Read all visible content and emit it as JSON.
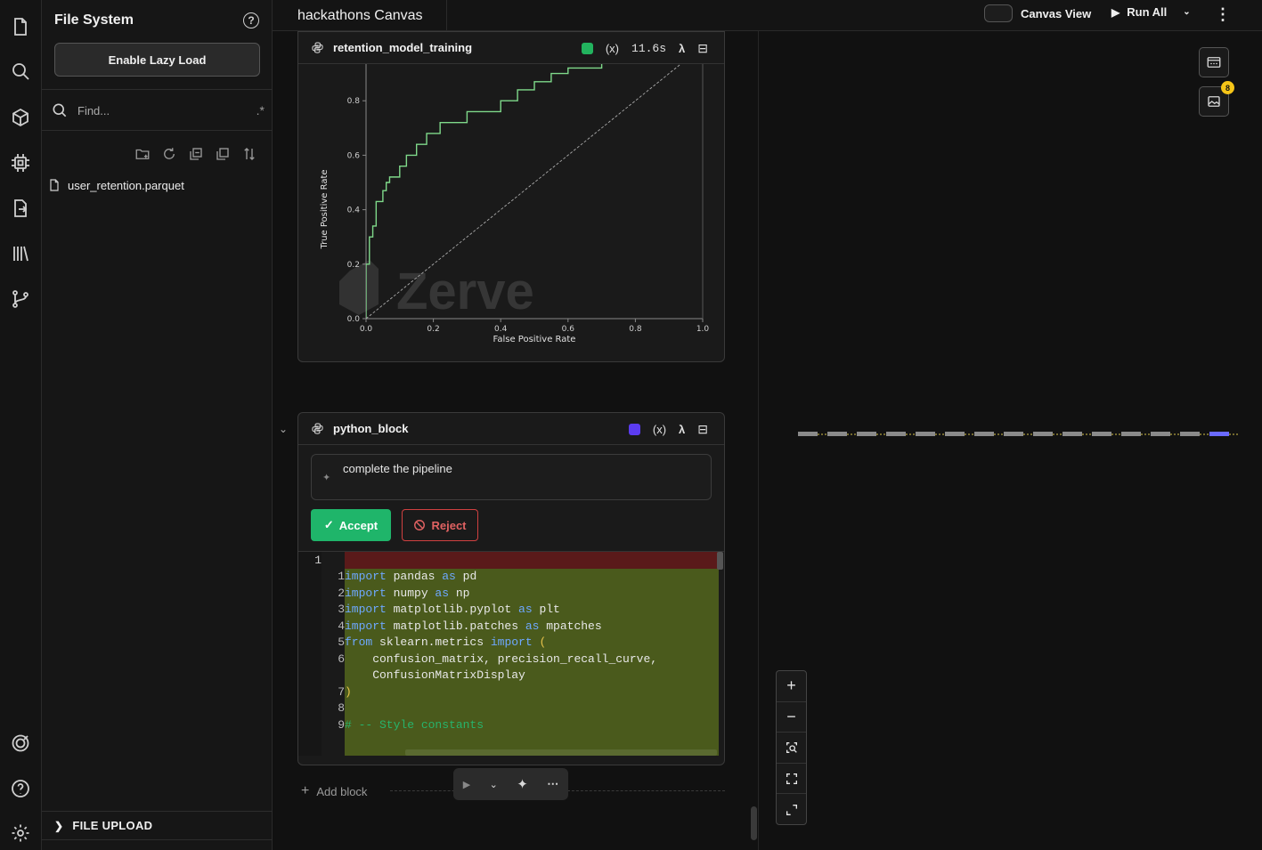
{
  "sidebar": {
    "title": "File System",
    "lazy_load_label": "Enable Lazy Load",
    "find_placeholder": "Find...",
    "files": [
      "user_retention.parquet"
    ],
    "file_upload_label": "FILE UPLOAD"
  },
  "topbar": {
    "canvas_title": "hackathons Canvas",
    "canvas_view_label": "Canvas View",
    "run_all_label": "Run All"
  },
  "block1": {
    "title": "retention_model_training",
    "var_label": "(x)",
    "runtime": "11.6s",
    "lambda": "λ",
    "status_color": "#22b35e",
    "watermark": "Zerve"
  },
  "block2": {
    "title": "python_block",
    "var_label": "(x)",
    "lambda": "λ",
    "status_color": "#5b3cf0",
    "prompt": "complete the pipeline",
    "accept_label": "Accept",
    "reject_label": "Reject"
  },
  "chart_data": {
    "type": "line",
    "xlabel": "False Positive Rate",
    "ylabel": "True Positive Rate",
    "xlim": [
      0,
      1
    ],
    "ylim": [
      0,
      1
    ],
    "x_ticks": [
      "0.0",
      "0.2",
      "0.4",
      "0.6",
      "0.8",
      "1.0"
    ],
    "y_ticks": [
      "0.0",
      "0.2",
      "0.4",
      "0.6",
      "0.8"
    ],
    "series": [
      {
        "color": "#7fd98a",
        "x": [
          0.0,
          0.0,
          0.01,
          0.02,
          0.03,
          0.05,
          0.06,
          0.07,
          0.1,
          0.12,
          0.15,
          0.18,
          0.22,
          0.25,
          0.3,
          0.35,
          0.4,
          0.45,
          0.5,
          0.55,
          0.6,
          0.7,
          0.78
        ],
        "y": [
          0.0,
          0.2,
          0.3,
          0.34,
          0.43,
          0.47,
          0.5,
          0.52,
          0.56,
          0.6,
          0.64,
          0.68,
          0.72,
          0.72,
          0.76,
          0.76,
          0.8,
          0.84,
          0.87,
          0.9,
          0.92,
          0.94,
          0.99
        ]
      },
      {
        "color": "#aaaaaa",
        "style": "dashed",
        "x": [
          0,
          1
        ],
        "y": [
          0,
          1
        ]
      }
    ]
  },
  "editor": {
    "gutter_first": "1",
    "lines": [
      {
        "n": "1",
        "parts": [
          [
            "kw",
            "import"
          ],
          [
            "plain",
            " pandas "
          ],
          [
            "kw",
            "as"
          ],
          [
            "plain",
            " pd"
          ]
        ]
      },
      {
        "n": "2",
        "parts": [
          [
            "kw",
            "import"
          ],
          [
            "plain",
            " numpy "
          ],
          [
            "kw",
            "as"
          ],
          [
            "plain",
            " np"
          ]
        ]
      },
      {
        "n": "3",
        "parts": [
          [
            "kw",
            "import"
          ],
          [
            "plain",
            " matplotlib.pyplot "
          ],
          [
            "kw",
            "as"
          ],
          [
            "plain",
            " plt"
          ]
        ]
      },
      {
        "n": "4",
        "parts": [
          [
            "kw",
            "import"
          ],
          [
            "plain",
            " matplotlib.patches "
          ],
          [
            "kw",
            "as"
          ],
          [
            "plain",
            " mpatches"
          ]
        ]
      },
      {
        "n": "5",
        "parts": [
          [
            "kw",
            "from"
          ],
          [
            "plain",
            " sklearn.metrics "
          ],
          [
            "kw",
            "import"
          ],
          [
            "par",
            " ("
          ]
        ]
      },
      {
        "n": "6",
        "parts": [
          [
            "plain",
            "    confusion_matrix, precision_recall_curve,"
          ]
        ]
      },
      {
        "n": "",
        "parts": [
          [
            "plain",
            "    ConfusionMatrixDisplay"
          ]
        ]
      },
      {
        "n": "7",
        "parts": [
          [
            "par",
            ")"
          ]
        ]
      },
      {
        "n": "8",
        "parts": []
      },
      {
        "n": "9",
        "parts": [
          [
            "cmt",
            "# -- Style constants"
          ]
        ]
      }
    ]
  },
  "bottom": {
    "add_block_label": "Add block"
  },
  "badges": {
    "notifications": "8"
  }
}
